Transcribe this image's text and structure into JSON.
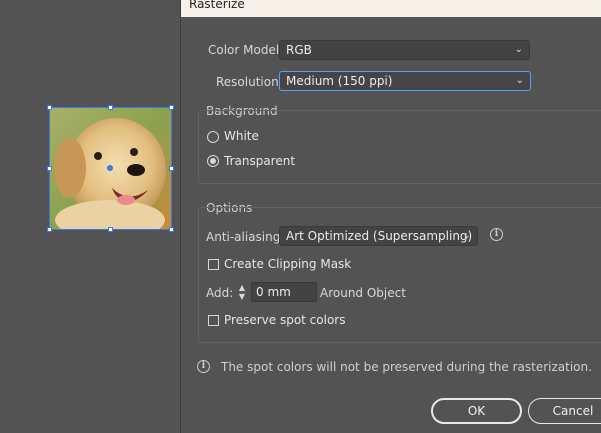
{
  "dialog": {
    "title": "Rasterize",
    "color_model": {
      "label": "Color Model:",
      "value": "RGB"
    },
    "resolution": {
      "label": "Resolution:",
      "value": "Medium (150 ppi)"
    },
    "background": {
      "title": "Background",
      "options": [
        {
          "label": "White",
          "selected": false
        },
        {
          "label": "Transparent",
          "selected": true
        }
      ]
    },
    "options": {
      "title": "Options",
      "anti_aliasing": {
        "label": "Anti-aliasing:",
        "value": "Art Optimized (Supersampling)"
      },
      "create_clipping_mask": {
        "label": "Create Clipping Mask",
        "checked": false
      },
      "add": {
        "label": "Add:",
        "value": "0 mm",
        "suffix": "Around Object"
      },
      "preserve_spot_colors": {
        "label": "Preserve spot colors",
        "checked": false
      }
    },
    "note": "The spot colors will not be preserved during the rasterization.",
    "buttons": {
      "ok": "OK",
      "cancel": "Cancel"
    }
  },
  "icons": {
    "chevron": "chevron-down-icon",
    "info": "info-icon",
    "stepper": "stepper-icon"
  },
  "colors": {
    "background": "#535353",
    "selection": "#3b7be0",
    "focus_ring": "#5aa0ee",
    "title_bar": "#f7f1ea"
  }
}
